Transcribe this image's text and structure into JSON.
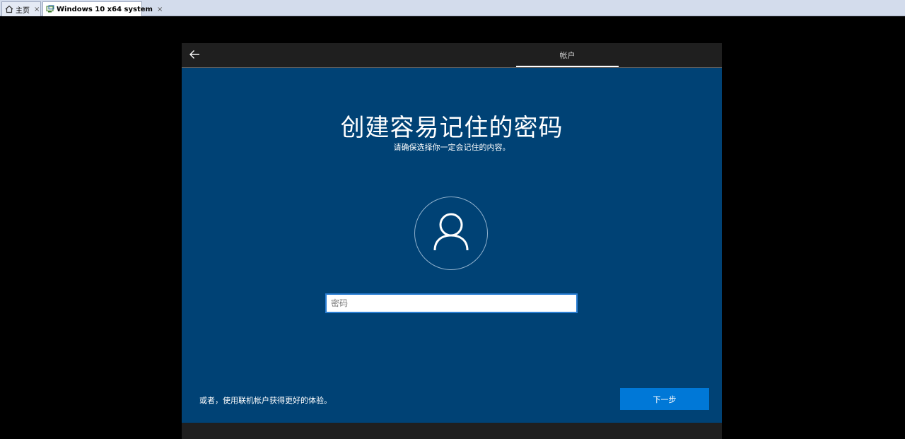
{
  "tabs": [
    {
      "label": "主页",
      "icon": "home-icon"
    },
    {
      "label": "Windows 10 x64 system",
      "icon": "vm-icon"
    }
  ],
  "tab_close_glyph": "×",
  "oobe": {
    "back_icon": "arrow-left-icon",
    "step_label": "帐户",
    "title": "创建容易记住的密码",
    "subtitle": "请确保选择你一定会记住的内容。",
    "avatar_icon": "user-icon",
    "password_placeholder": "密码",
    "alt_link": "或者，使用联机帐户获得更好的体验。",
    "next_label": "下一步"
  },
  "colors": {
    "accent": "#0078d7",
    "background": "#004275",
    "chrome": "#1f1f1f"
  }
}
